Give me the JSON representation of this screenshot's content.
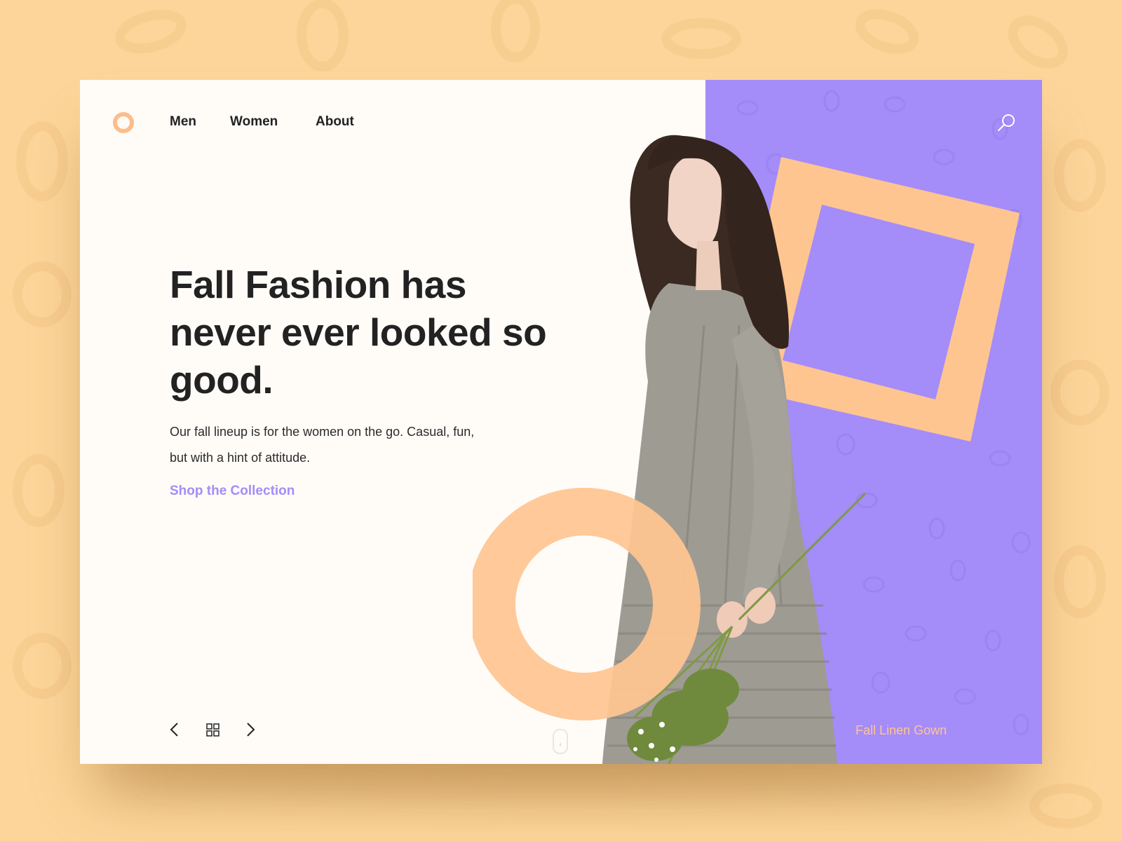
{
  "nav": {
    "items": [
      {
        "label": "Men"
      },
      {
        "label": "Women"
      },
      {
        "label": "About"
      }
    ]
  },
  "hero": {
    "title": "Fall Fashion has never ever looked so good.",
    "description": "Our fall lineup is for the women on the go. Casual, fun, but with a hint of attitude.",
    "cta_label": "Shop the Collection"
  },
  "product": {
    "caption": "Fall Linen Gown"
  },
  "colors": {
    "background": "#fdd59a",
    "card": "#fffcf8",
    "accent_purple": "#a48cf9",
    "accent_peach": "#ffc591",
    "text_dark": "#222222"
  },
  "icons": {
    "logo": "ring-logo-icon",
    "search": "search-icon",
    "prev": "chevron-left-icon",
    "grid": "grid-icon",
    "next": "chevron-right-icon",
    "scroll": "mouse-scroll-icon"
  }
}
